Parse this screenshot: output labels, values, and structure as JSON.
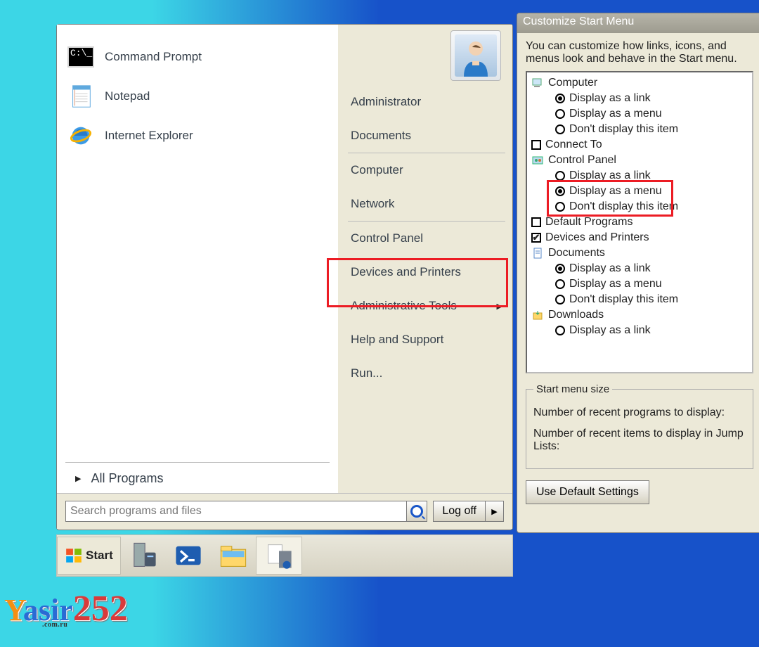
{
  "startmenu": {
    "apps": [
      {
        "label": "Command Prompt"
      },
      {
        "label": "Notepad"
      },
      {
        "label": "Internet Explorer"
      }
    ],
    "all_programs": "All Programs",
    "search_placeholder": "Search programs and files",
    "logoff": "Log off",
    "right": {
      "items": [
        {
          "label": "Administrator"
        },
        {
          "label": "Documents"
        },
        {
          "label": "Computer"
        },
        {
          "label": "Network"
        },
        {
          "label": "Control Panel"
        },
        {
          "label": "Devices and Printers"
        },
        {
          "label": "Administrative Tools"
        },
        {
          "label": "Help and Support"
        },
        {
          "label": "Run..."
        }
      ]
    }
  },
  "taskbar": {
    "start": "Start"
  },
  "customize": {
    "title": "Customize Start Menu",
    "desc": "You can customize how links, icons, and menus look and behave in the Start menu.",
    "tree": {
      "computer": "Computer",
      "computer_opts": [
        "Display as a link",
        "Display as a menu",
        "Don't display this item"
      ],
      "connect_to": "Connect To",
      "control_panel": "Control Panel",
      "control_panel_opts": [
        "Display as a link",
        "Display as a menu",
        "Don't display this item"
      ],
      "default_programs": "Default Programs",
      "devices_printers": "Devices and Printers",
      "documents": "Documents",
      "documents_opts": [
        "Display as a link",
        "Display as a menu",
        "Don't display this item"
      ],
      "downloads": "Downloads",
      "downloads_opts": [
        "Display as a link"
      ]
    },
    "sms_legend": "Start menu size",
    "sms_row1": "Number of recent programs to display:",
    "sms_row2": "Number of recent items to display in Jump Lists:",
    "use_defaults": "Use Default Settings"
  },
  "watermark": {
    "text1": "Y",
    "text2": "asir",
    "text3": "252",
    "sub": ".com.ru"
  }
}
